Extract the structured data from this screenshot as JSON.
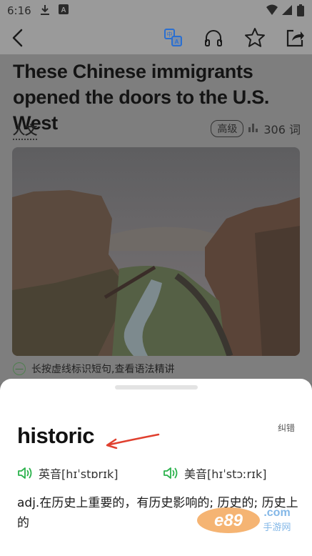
{
  "status_bar": {
    "time": "6:16",
    "left_icons": [
      "download-icon",
      "font-icon"
    ],
    "right_icons": [
      "wifi-icon",
      "signal-icon",
      "battery-icon"
    ]
  },
  "toolbar": {
    "back": "back-icon",
    "actions": [
      "translate-icon",
      "headphones-icon",
      "star-icon",
      "share-icon"
    ]
  },
  "article": {
    "title": "These Chinese immigrants opened the doors to the U.S. West",
    "category": "人文",
    "level": "高级",
    "word_count": "306 词",
    "hint": "长按虚线标识短句,查看语法精讲"
  },
  "word_sheet": {
    "word": "historic",
    "report_label": "纠错",
    "uk_pron": "英音[hɪˈstɒrɪk]",
    "us_pron": "美音[hɪˈstɔːrɪk]",
    "definition": "adj.在历史上重要的，有历史影响的; 历史的; 历史上的"
  },
  "colors": {
    "accent_green": "#2bb24c",
    "arrow_red": "#e0402f",
    "watermark_orange": "#f08a24"
  }
}
